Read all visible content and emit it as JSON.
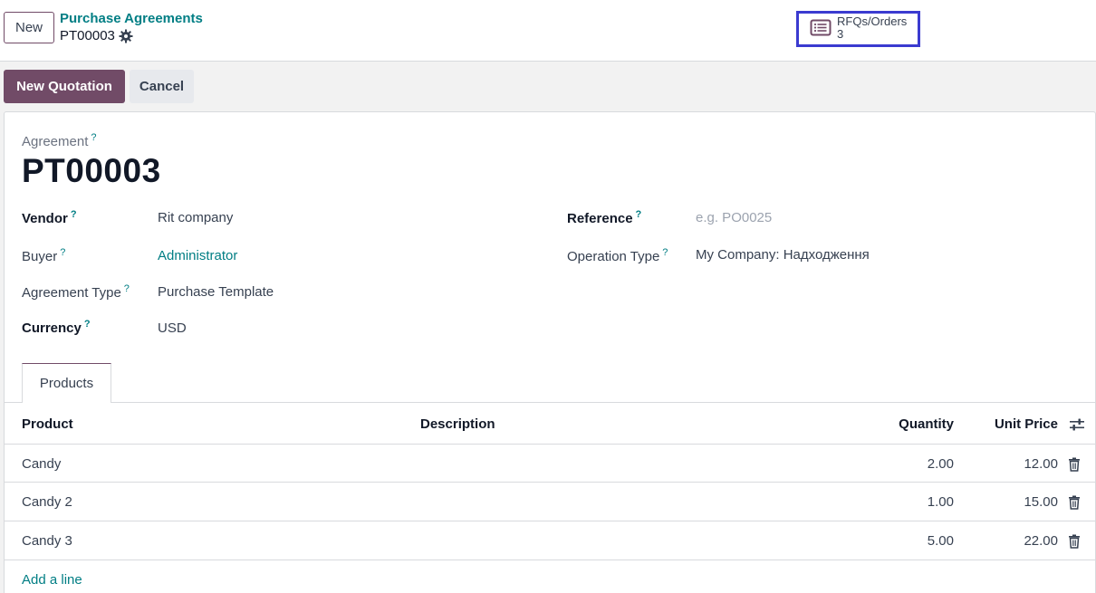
{
  "header": {
    "new_label": "New",
    "breadcrumb": "Purchase Agreements",
    "record_name": "PT00003"
  },
  "smart_button": {
    "label": "RFQs/Orders",
    "count": "3",
    "icon": "list-icon"
  },
  "actions": {
    "new_quotation": "New Quotation",
    "cancel": "Cancel"
  },
  "form": {
    "agreement_label": "Agreement",
    "agreement_name": "PT00003",
    "vendor_label": "Vendor",
    "vendor_value": "Rit company",
    "buyer_label": "Buyer",
    "buyer_value": "Administrator",
    "agreement_type_label": "Agreement Type",
    "agreement_type_value": "Purchase Template",
    "currency_label": "Currency",
    "currency_value": "USD",
    "reference_label": "Reference",
    "reference_placeholder": "e.g. PO0025",
    "operation_type_label": "Operation Type",
    "operation_type_value": "My Company: Надходження",
    "help_mark": "?"
  },
  "tabs": [
    {
      "label": "Products"
    }
  ],
  "table": {
    "columns": {
      "product": "Product",
      "description": "Description",
      "quantity": "Quantity",
      "unit_price": "Unit Price"
    },
    "rows": [
      {
        "product": "Candy",
        "description": "",
        "quantity": "2.00",
        "unit_price": "12.00"
      },
      {
        "product": "Candy 2",
        "description": "",
        "quantity": "1.00",
        "unit_price": "15.00"
      },
      {
        "product": "Candy 3",
        "description": "",
        "quantity": "5.00",
        "unit_price": "22.00"
      }
    ],
    "add_line": "Add a line"
  },
  "colors": {
    "brand": "#714b67",
    "link": "#017e84",
    "highlight_border": "#3b3bd0"
  }
}
